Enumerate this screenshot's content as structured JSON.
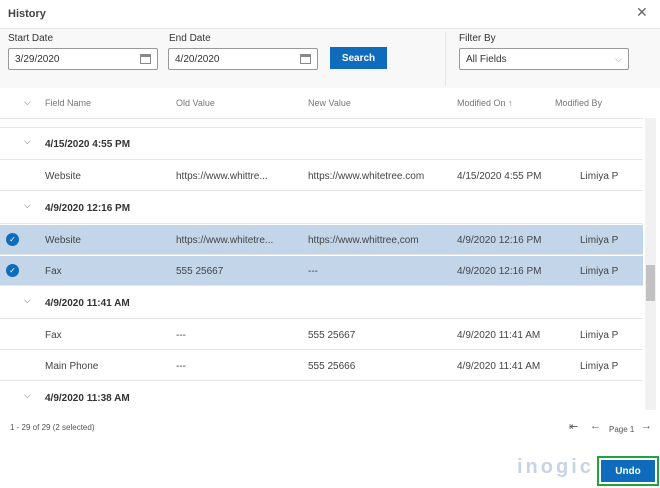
{
  "dialog": {
    "title": "History",
    "close_icon": "close-icon"
  },
  "filters": {
    "start_label": "Start Date",
    "start_value": "3/29/2020",
    "end_label": "End Date",
    "end_value": "4/20/2020",
    "search_label": "Search",
    "filter_label": "Filter By",
    "filter_value": "All Fields"
  },
  "columns": [
    "Field Name",
    "Old Value",
    "New Value",
    "Modified On ↑",
    "Modified By"
  ],
  "groups": [
    {
      "title": "4/15/2020 4:55 PM",
      "rows": [
        {
          "field": "Website",
          "old": "https://www.whittre...",
          "new": "https://www.whitetree.com",
          "on": "4/15/2020 4:55 PM",
          "by": "Limiya P",
          "selected": false
        }
      ]
    },
    {
      "title": "4/9/2020 12:16 PM",
      "rows": [
        {
          "field": "Website",
          "old": "https://www.whitetre...",
          "new": "https://www.whittree,com",
          "on": "4/9/2020 12:16 PM",
          "by": "Limiya P",
          "selected": true
        },
        {
          "field": "Fax",
          "old": "555 25667",
          "new": "---",
          "on": "4/9/2020 12:16 PM",
          "by": "Limiya P",
          "selected": true
        }
      ]
    },
    {
      "title": "4/9/2020 11:41 AM",
      "rows": [
        {
          "field": "Fax",
          "old": "---",
          "new": "555 25667",
          "on": "4/9/2020 11:41 AM",
          "by": "Limiya P",
          "selected": false
        },
        {
          "field": "Main Phone",
          "old": "---",
          "new": "555 25666",
          "on": "4/9/2020 11:41 AM",
          "by": "Limiya P",
          "selected": false
        }
      ]
    },
    {
      "title": "4/9/2020 11:38 AM",
      "rows": []
    }
  ],
  "footer": {
    "count": "1 - 29 of 29 (2 selected)",
    "page": "Page 1",
    "undo_label": "Undo",
    "logo": "inogic"
  },
  "colors": {
    "accent": "#0f6cbd",
    "selected_row": "#c3d5e8",
    "undo_border": "#22a33a"
  }
}
